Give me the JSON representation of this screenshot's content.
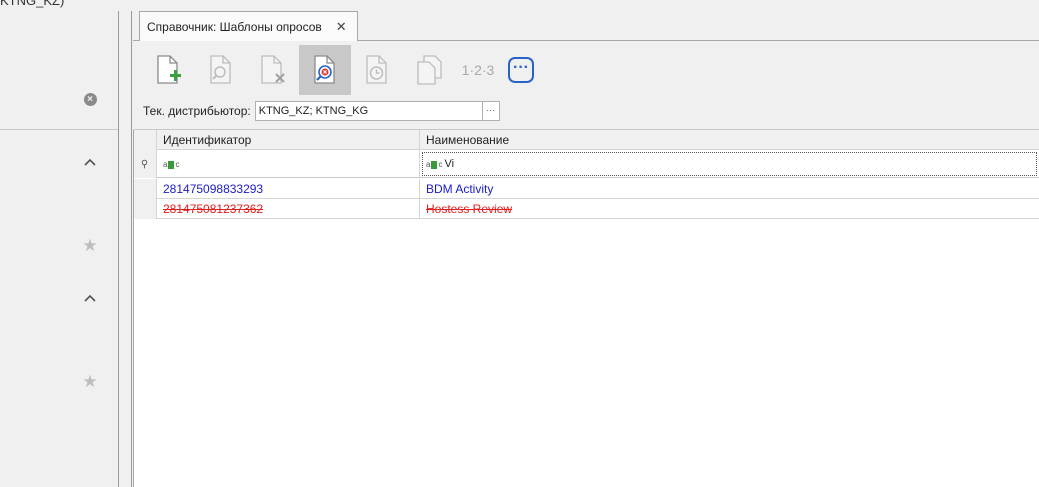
{
  "left_panel": {
    "title": "KTNG_KZ)"
  },
  "tab": {
    "label": "Справочник: Шаблоны опросов",
    "close": "✕"
  },
  "toolbar": {
    "numbering_label": "1·2·3",
    "more_label": "···"
  },
  "distributor": {
    "label": "Тек. дистрибьютор:",
    "value": "KTNG_KZ; KTNG_KG",
    "button": "···"
  },
  "grid": {
    "columns": [
      "Идентификатор",
      "Наименование"
    ],
    "filter": {
      "col1": "",
      "col2": "Vi"
    },
    "rows": [
      {
        "id": "281475098833293",
        "name": "BDM Activity",
        "status": "active"
      },
      {
        "id": "281475081237362",
        "name": "Hostess Review",
        "status": "deleted"
      }
    ]
  },
  "colors": {
    "active_row": "#1b1bc8",
    "deleted_row": "#e02020",
    "accent": "#2a63c8"
  }
}
